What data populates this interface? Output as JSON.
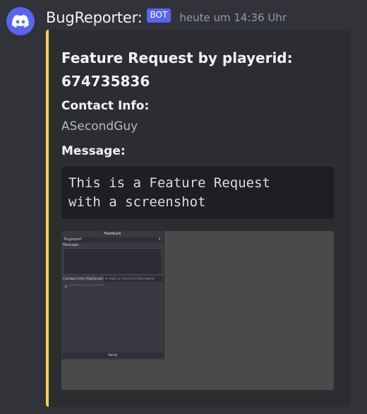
{
  "message": {
    "username": "BugReporter:",
    "badge": "BOT",
    "timestamp": "heute um 14:36 Uhr"
  },
  "embed": {
    "accent_color": "#f0d74b",
    "title_line1": "Feature Request by playerid:",
    "title_line2": "674735836",
    "fields": {
      "contact_name": "Contact Info:",
      "contact_value": "ASecondGuy",
      "message_name": "Message:",
      "message_value": "This is a Feature Request\nwith a screenshot"
    }
  },
  "screenshot": {
    "window_title": "Feedback",
    "dropdown_value": "Bugreport",
    "dropdown_arrow": "⇕",
    "message_label": "Message:",
    "contact_label": "Contact Info (Optional):",
    "contact_placeholder": "e-mail or Discord Username",
    "attach_label": "attach last screenshot",
    "send_label": "Send"
  },
  "colors": {
    "background": "#313338",
    "embed_bg": "#2b2d31",
    "avatar_bg": "#5865f2",
    "badge_bg": "#5865f2"
  },
  "icons": {
    "avatar": "discord-logo-icon"
  }
}
